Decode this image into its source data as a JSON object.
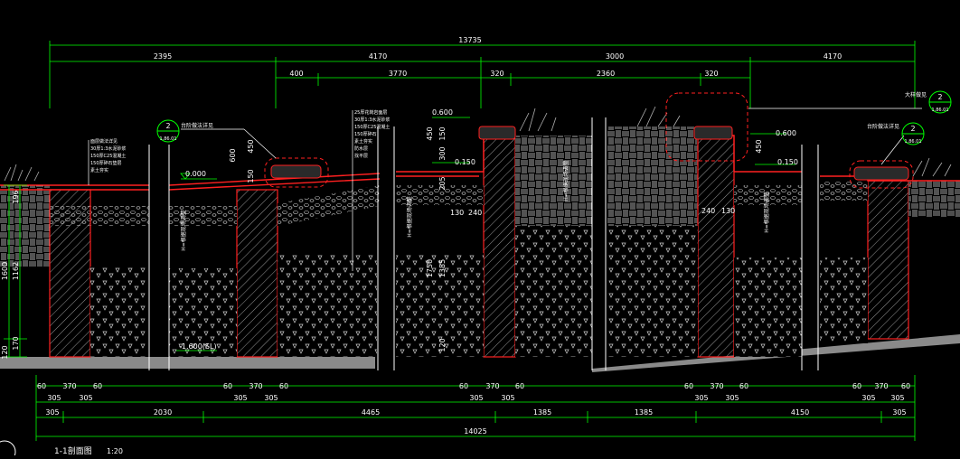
{
  "colors": {
    "background": "#000000",
    "dimension": "#00ff00",
    "outline": "#ff2020",
    "hatch": "#d8d8d8",
    "text": "#ffffff",
    "leader": "#ffffff",
    "ground": "#8a8a8a",
    "plant": "#b0b0b0",
    "callout": "#00ff00"
  },
  "top_dims": {
    "overall": "13735",
    "row2": [
      "2395",
      "4170",
      "3000",
      "4170"
    ],
    "row3": [
      "400",
      "3770",
      "320",
      "2360",
      "320"
    ]
  },
  "bottom_dims": {
    "row1_groups": [
      [
        "60",
        "370",
        "60"
      ],
      [
        "60",
        "370",
        "60"
      ],
      [
        "60",
        "370",
        "60"
      ],
      [
        "60",
        "370",
        "60"
      ],
      [
        "60",
        "370",
        "60"
      ]
    ],
    "row2_groups": [
      [
        "305",
        "305"
      ],
      [
        "305",
        "305"
      ],
      [
        "305",
        "305"
      ],
      [
        "305",
        "305"
      ],
      [
        "305",
        "305"
      ]
    ],
    "row3": [
      "305",
      "2030",
      "4465",
      "1385",
      "1385",
      "4150",
      "305"
    ],
    "overall": "14025"
  },
  "left_dims": [
    "1600",
    "1162",
    "196",
    "170",
    "120"
  ],
  "callouts": [
    {
      "num": "2",
      "sheet": "1.86.01",
      "label": "台阶做法详见"
    },
    {
      "num": "2",
      "sheet": "1.86.01",
      "label": "台阶做法详见"
    },
    {
      "num": "2",
      "sheet": "1.86.01",
      "label": "大样做见"
    }
  ],
  "elevations": {
    "zero": "0.000",
    "minus": "-1.600(SL)",
    "e600_left": "0.600",
    "e600_right": "0.600",
    "e150_left": "0.150",
    "e150_right": "0.150"
  },
  "mid_dims": {
    "d600": "600",
    "d450a": "450",
    "d150a": "150",
    "d150b": "150",
    "d300": "300",
    "d205": "205",
    "d450b": "450",
    "d450c": "450",
    "d1750": "1750",
    "d1385": "1385",
    "d120": "120",
    "d130a": "130",
    "d240a": "240",
    "d240b": "240",
    "d130b": "130"
  },
  "wall_labels": [
    "H=根据现场调整",
    "H=根据现场调整",
    "H=根据现场调整",
    "H=根据现场调整"
  ],
  "layer_notes_left": [
    "面层做法详见",
    "30厚1:3水泥砂浆",
    "150厚C25混凝土",
    "150厚碎石垫层",
    "素土夯实"
  ],
  "layer_notes_mid": [
    "25厚花岗岩面层",
    "30厚1:3水泥砂浆",
    "150厚C25混凝土",
    "150厚碎石",
    "素土夯实",
    "防水层",
    "找平层"
  ],
  "title": "1-1剖面图",
  "scale": "1:20"
}
